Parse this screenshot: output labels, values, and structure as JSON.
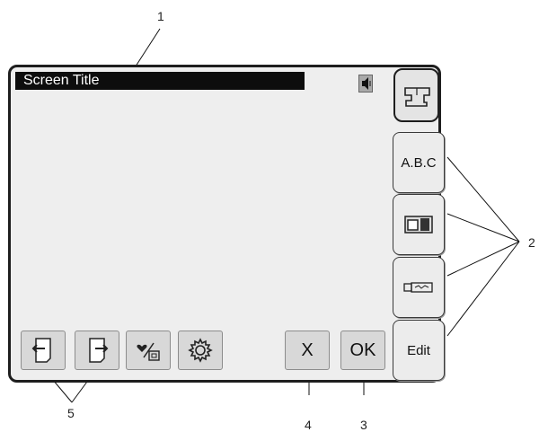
{
  "screen": {
    "title": "Screen Title"
  },
  "side_tabs": [
    {
      "label": "A.B.C",
      "icon": "abc-text"
    },
    {
      "label": "",
      "icon": "camera-icon"
    },
    {
      "label": "",
      "icon": "usb-stick-icon"
    },
    {
      "label": "Edit",
      "icon": ""
    }
  ],
  "bottom_buttons": {
    "prev_icon": "page-back-icon",
    "next_icon": "page-forward-icon",
    "memory_icon": "heart-memory-icon",
    "settings_icon": "gear-icon",
    "cancel_label": "X",
    "ok_label": "OK"
  },
  "callouts": [
    "1",
    "2",
    "3",
    "4",
    "5"
  ]
}
